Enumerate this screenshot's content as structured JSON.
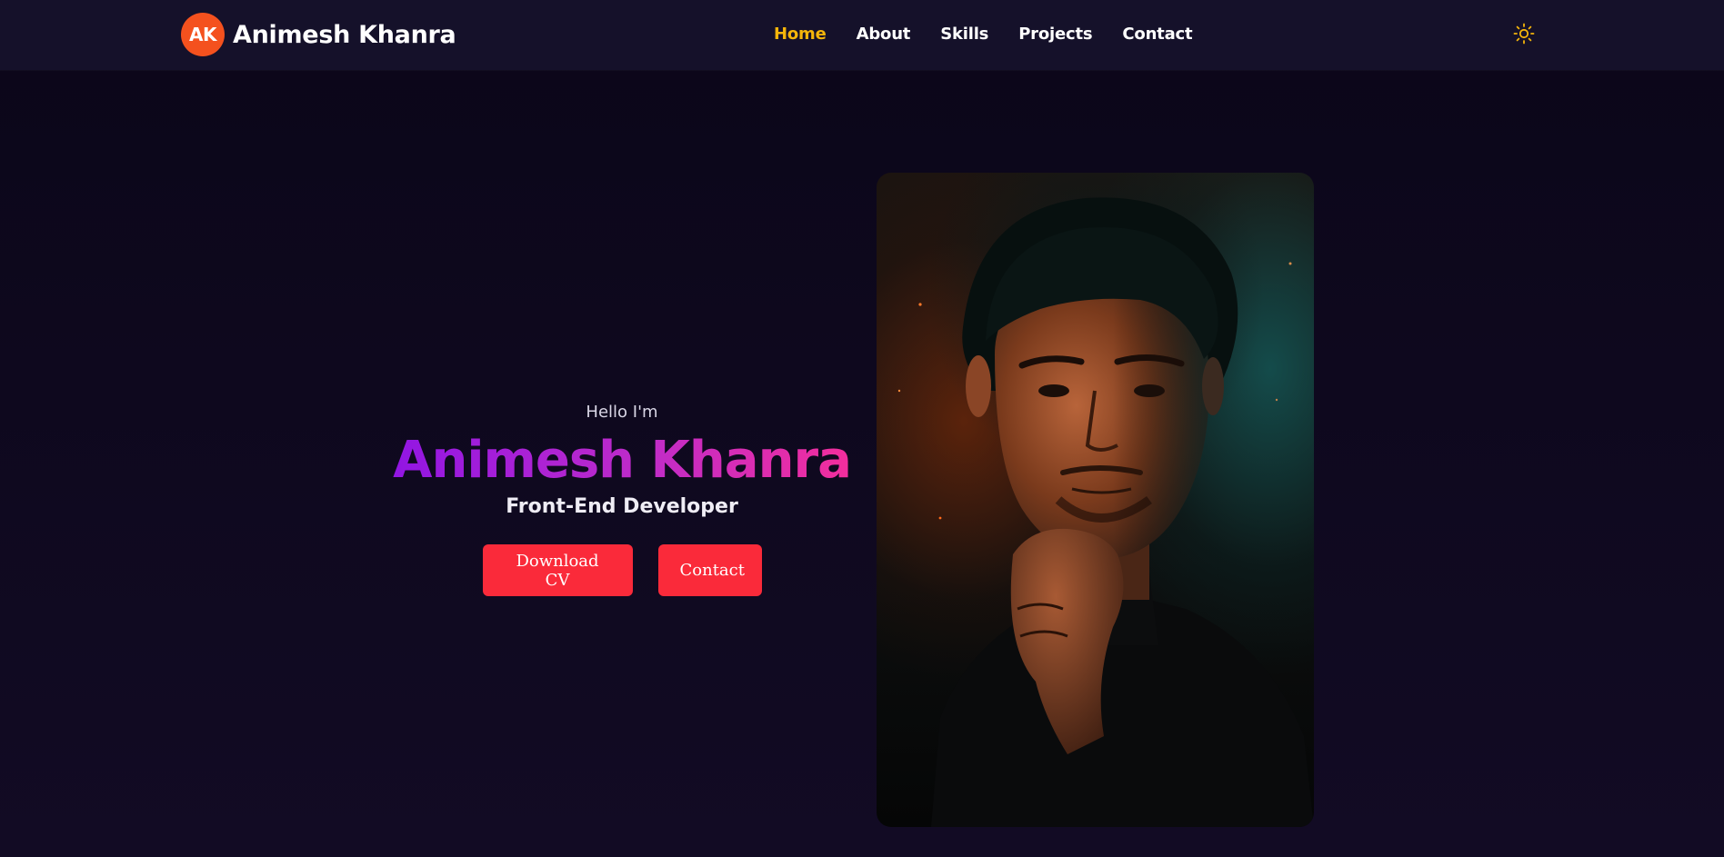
{
  "header": {
    "logo_initials": "AK",
    "brand_name": "Animesh Khanra",
    "nav": [
      {
        "label": "Home",
        "active": true
      },
      {
        "label": "About",
        "active": false
      },
      {
        "label": "Skills",
        "active": false
      },
      {
        "label": "Projects",
        "active": false
      },
      {
        "label": "Contact",
        "active": false
      }
    ],
    "theme_toggle_icon": "sun-icon"
  },
  "hero": {
    "greeting": "Hello I'm",
    "name": "Animesh Khanra",
    "role": "Front-End Developer",
    "buttons": {
      "download_cv": "Download CV",
      "contact": "Contact"
    }
  },
  "colors": {
    "accent_active_nav": "#f5b50a",
    "logo_badge": "#f4511e",
    "button_bg": "#fa2a3a",
    "name_gradient_start": "#8a12e8",
    "name_gradient_end": "#ff2e93",
    "page_bg": "#0b0619"
  }
}
